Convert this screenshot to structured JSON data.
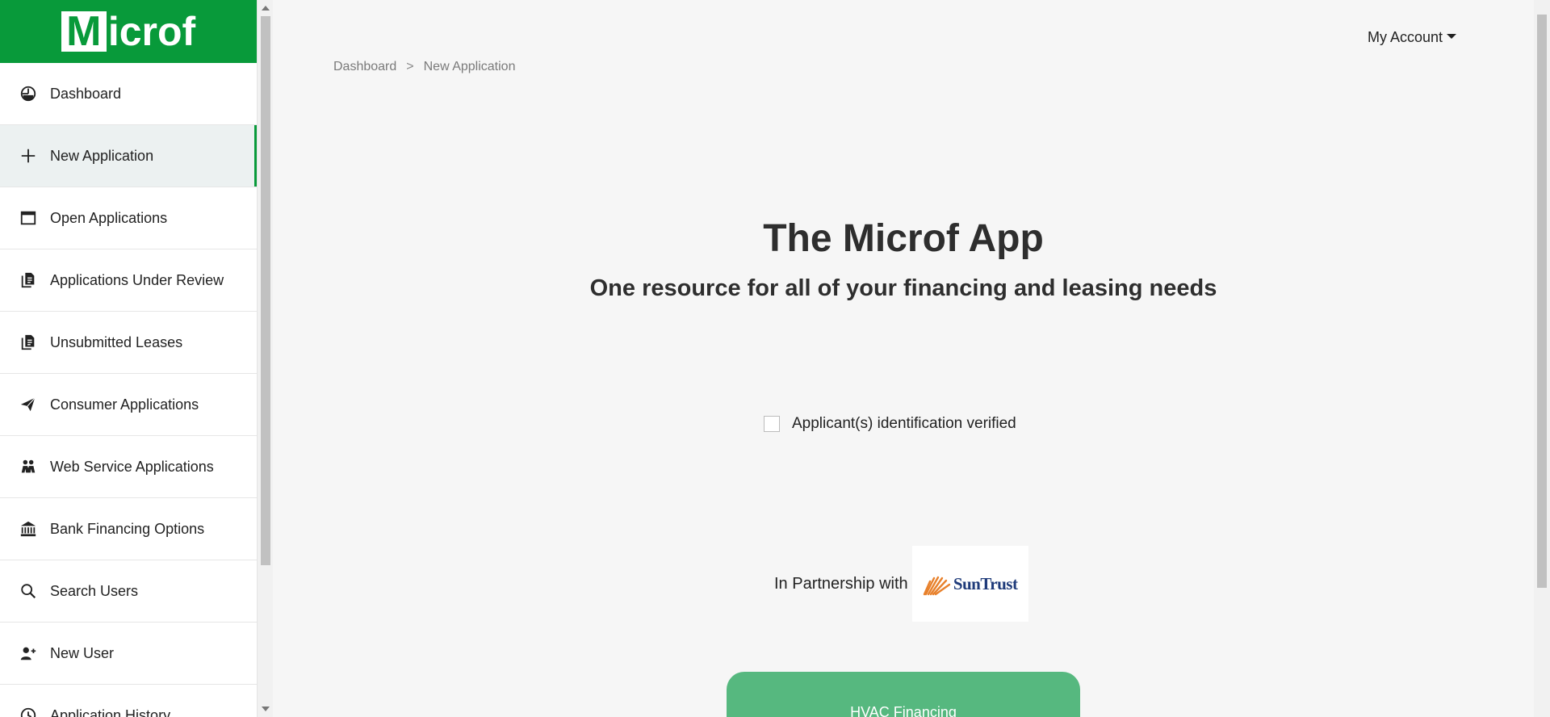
{
  "app": {
    "logo_letter": "M",
    "logo_rest": "icrof",
    "brand_color": "#089a3a"
  },
  "sidebar": {
    "items": [
      {
        "label": "Dashboard",
        "icon": "dashboard-gauge-icon"
      },
      {
        "label": "New Application",
        "icon": "plus-icon",
        "active": true
      },
      {
        "label": "Open Applications",
        "icon": "window-icon"
      },
      {
        "label": "Applications Under Review",
        "icon": "documents-icon"
      },
      {
        "label": "Unsubmitted Leases",
        "icon": "documents-icon"
      },
      {
        "label": "Consumer Applications",
        "icon": "paper-plane-icon"
      },
      {
        "label": "Web Service Applications",
        "icon": "people-icon"
      },
      {
        "label": "Bank Financing Options",
        "icon": "bank-icon"
      },
      {
        "label": "Search Users",
        "icon": "search-icon"
      },
      {
        "label": "New User",
        "icon": "add-user-icon"
      },
      {
        "label": "Application History",
        "icon": "clock-icon"
      }
    ]
  },
  "header": {
    "account_label": "My Account"
  },
  "breadcrumb": {
    "items": [
      "Dashboard",
      "New Application"
    ],
    "separator": ">"
  },
  "main": {
    "title": "The Microf App",
    "subtitle": "One resource for all of your financing and leasing needs",
    "verify_label": "Applicant(s) identification verified",
    "verify_checked": false,
    "partner_label": "In Partnership with",
    "partner_logo_text": "SunTrust",
    "cta_label": "HVAC Financing",
    "cta_color": "#56b87f"
  }
}
